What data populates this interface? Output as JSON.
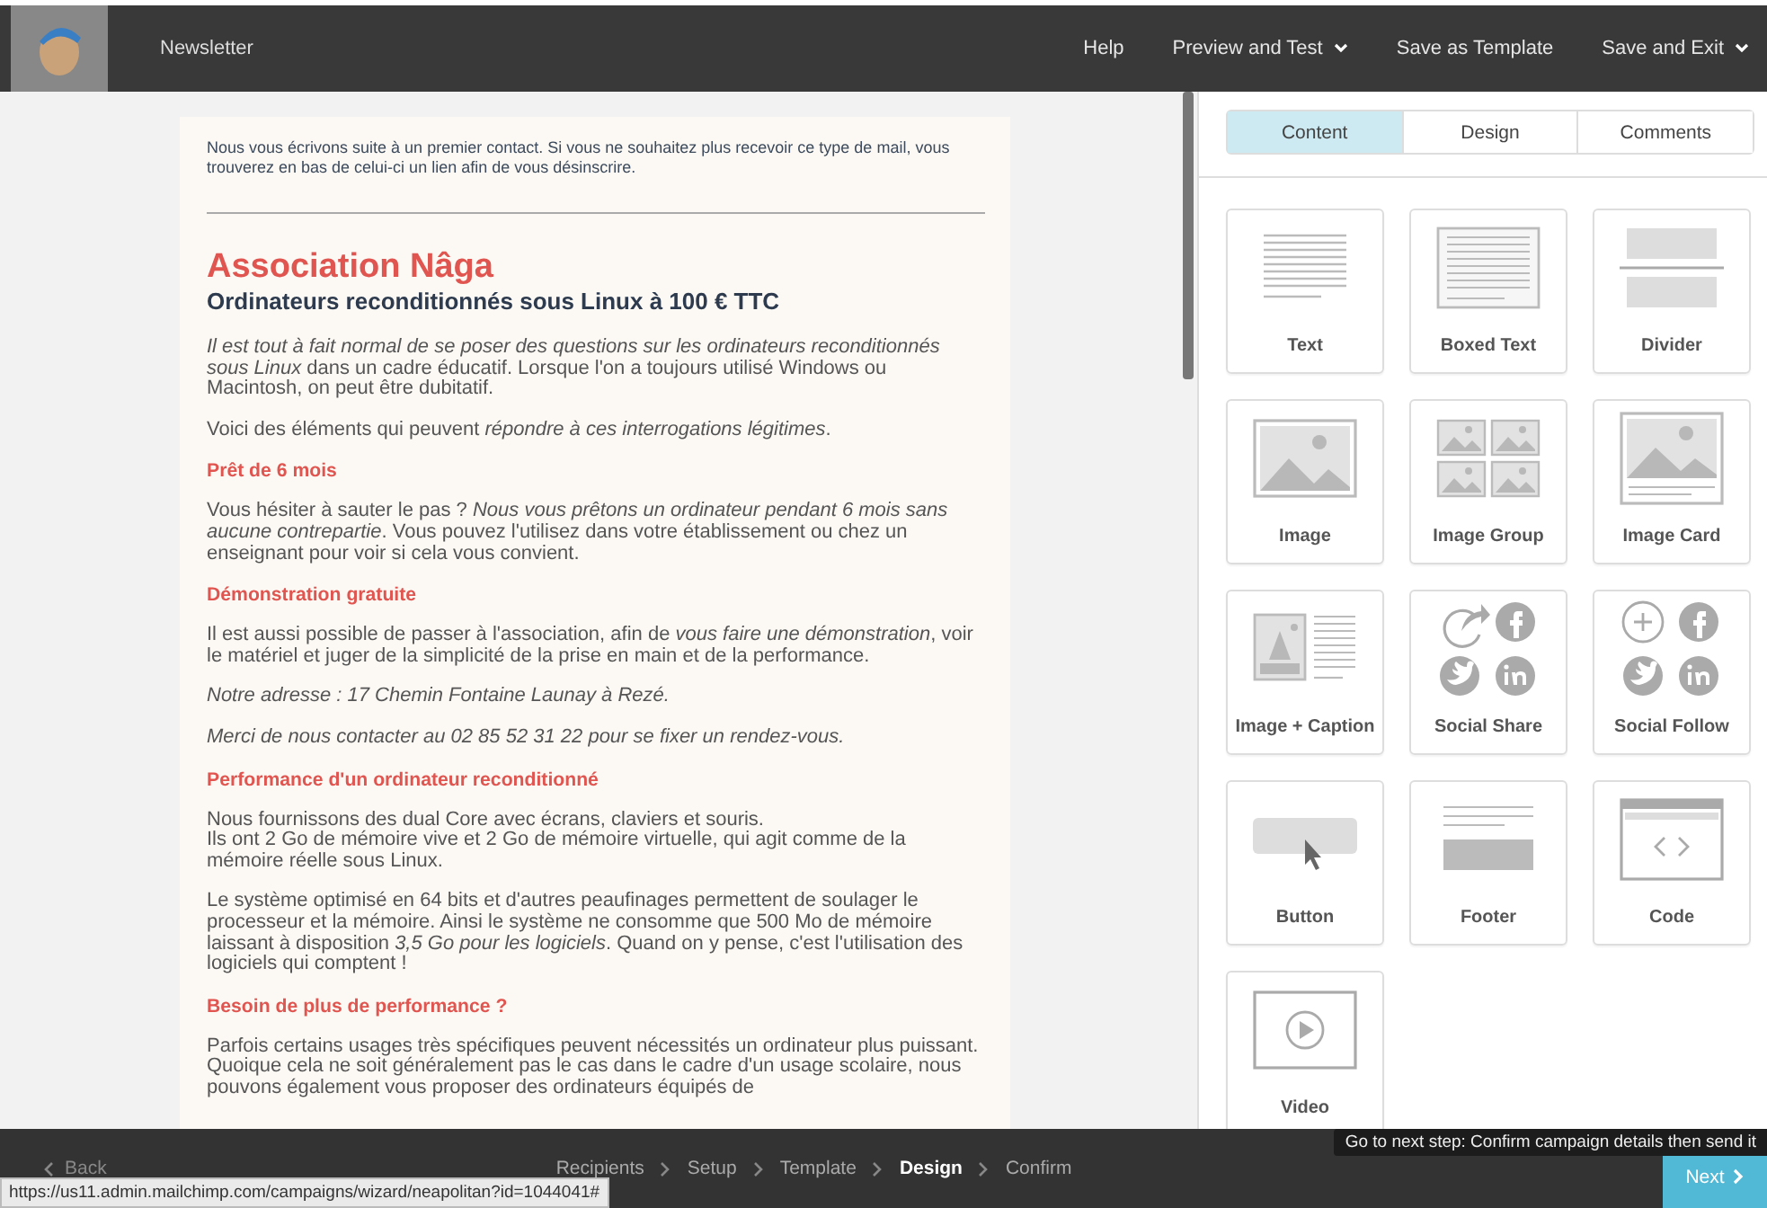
{
  "header": {
    "title": "Newsletter",
    "menu": [
      {
        "label": "Help",
        "dropdown": false
      },
      {
        "label": "Preview and Test",
        "dropdown": true
      },
      {
        "label": "Save as Template",
        "dropdown": false
      },
      {
        "label": "Save and Exit",
        "dropdown": true
      }
    ]
  },
  "email": {
    "preheader": "Nous vous écrivons suite à un premier contact. Si vous ne souhaitez plus recevoir ce type de mail, vous trouverez en bas de celui-ci un lien afin de vous désinscrire.",
    "title": "Association Nâga",
    "subtitle": "Ordinateurs reconditionnés sous Linux à 100 € TTC",
    "blocks": [
      {
        "kind": "p",
        "text": "*Il est tout à fait normal de se poser des questions sur les ordinateurs reconditionnés sous Linux* dans un cadre éducatif. Lorsque l'on a toujours utilisé Windows ou Macintosh, on peut être dubitatif."
      },
      {
        "kind": "p",
        "text": "Voici des éléments qui peuvent *répondre à ces interrogations légitimes*."
      },
      {
        "kind": "h",
        "text": "Prêt de 6 mois"
      },
      {
        "kind": "p",
        "text": "Vous hésiter à sauter le pas ? *Nous vous prêtons un ordinateur pendant 6 mois sans aucune contrepartie*. Vous pouvez l'utilisez dans votre établissement ou chez un enseignant pour voir si cela vous convient."
      },
      {
        "kind": "h",
        "text": "Démonstration gratuite"
      },
      {
        "kind": "p",
        "text": "Il est aussi possible de passer à l'association, afin de *vous faire une démonstration*, voir le matériel et juger de la simplicité de la prise en main et de la performance."
      },
      {
        "kind": "p",
        "text": "*Notre adresse : 17 Chemin Fontaine Launay à Rezé.*"
      },
      {
        "kind": "p",
        "text": "*Merci de nous contacter au 02 85 52 31 22 pour se fixer un rendez-vous.*"
      },
      {
        "kind": "h",
        "text": "Performance d'un ordinateur reconditionné"
      },
      {
        "kind": "p",
        "text": "Nous fournissons des dual Core avec écrans, claviers et souris.\nIls ont 2 Go de mémoire vive et 2 Go de mémoire virtuelle, qui agit comme de la mémoire réelle sous Linux."
      },
      {
        "kind": "p",
        "text": "Le système optimisé en 64 bits et d'autres peaufinages permettent de soulager le processeur et la mémoire. Ainsi le système ne consomme que 500 Mo de mémoire laissant à disposition *3,5 Go pour les logiciels*. Quand on y pense, c'est l'utilisation des logiciels qui comptent !"
      },
      {
        "kind": "h",
        "text": "Besoin de plus de performance ?"
      },
      {
        "kind": "p",
        "text": "Parfois certains usages très spécifiques peuvent nécessités un ordinateur plus puissant. Quoique cela ne soit généralement pas le cas dans le cadre d'un usage scolaire, nous pouvons également vous proposer des ordinateurs équipés de"
      }
    ]
  },
  "panel": {
    "tabs": [
      {
        "label": "Content",
        "selected": true
      },
      {
        "label": "Design",
        "selected": false
      },
      {
        "label": "Comments",
        "selected": false
      }
    ],
    "blocks": [
      {
        "kind": "text",
        "label": "Text"
      },
      {
        "kind": "boxed_text",
        "label": "Boxed Text"
      },
      {
        "kind": "divider",
        "label": "Divider"
      },
      {
        "kind": "image",
        "label": "Image"
      },
      {
        "kind": "image_group",
        "label": "Image Group"
      },
      {
        "kind": "image_card",
        "label": "Image Card"
      },
      {
        "kind": "image_caption",
        "label": "Image + Caption"
      },
      {
        "kind": "social_share",
        "label": "Social Share"
      },
      {
        "kind": "social_follow",
        "label": "Social Follow"
      },
      {
        "kind": "button",
        "label": "Button"
      },
      {
        "kind": "footer",
        "label": "Footer"
      },
      {
        "kind": "code",
        "label": "Code"
      },
      {
        "kind": "video",
        "label": "Video"
      }
    ]
  },
  "footer": {
    "back": "Back",
    "steps": [
      {
        "label": "Recipients",
        "selected": false
      },
      {
        "label": "Setup",
        "selected": false
      },
      {
        "label": "Template",
        "selected": false
      },
      {
        "label": "Design",
        "selected": true
      },
      {
        "label": "Confirm",
        "selected": false
      }
    ],
    "next": "Next",
    "tooltip": "Go to next step: Confirm campaign details then send it",
    "status_url": "https://us11.admin.mailchimp.com/campaigns/wizard/neapolitan?id=1044041#"
  }
}
